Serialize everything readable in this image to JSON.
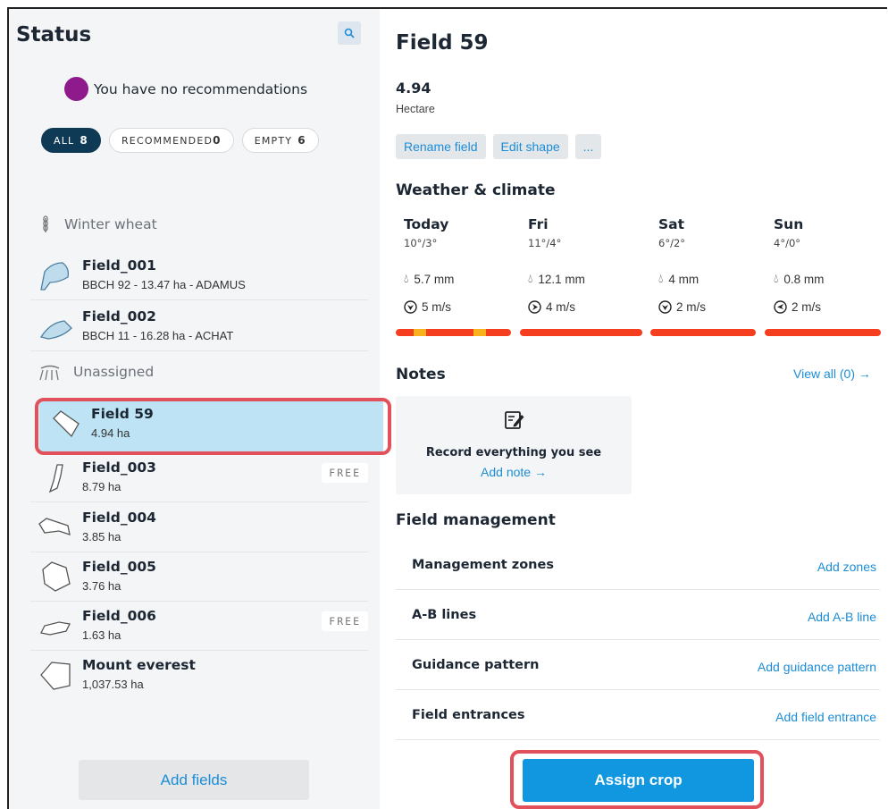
{
  "sidebar": {
    "title": "Status",
    "recommendation_text": "You have no recommendations",
    "filters": [
      {
        "label": "ALL",
        "count": "8"
      },
      {
        "label": "RECOMMENDED",
        "count": "0"
      },
      {
        "label": "EMPTY",
        "count": "6"
      }
    ],
    "groups": [
      {
        "label": "Winter wheat",
        "icon": "wheat-icon"
      },
      {
        "label": "Unassigned",
        "icon": "tractor-field-icon"
      }
    ],
    "fields": [
      {
        "name": "Field_001",
        "sub": "BBCH 92 - 13.47 ha - ADAMUS"
      },
      {
        "name": "Field_002",
        "sub": "BBCH 11 - 16.28 ha - ACHAT"
      },
      {
        "name": "Field 59",
        "sub": "4.94 ha"
      },
      {
        "name": "Field_003",
        "sub": "8.79 ha",
        "badge": "FREE"
      },
      {
        "name": "Field_004",
        "sub": "3.85 ha"
      },
      {
        "name": "Field_005",
        "sub": "3.76 ha"
      },
      {
        "name": "Field_006",
        "sub": "1.63 ha",
        "badge": "FREE"
      },
      {
        "name": "Mount everest",
        "sub": "1,037.53 ha"
      }
    ],
    "add_fields_label": "Add fields"
  },
  "detail": {
    "title": "Field 59",
    "area_value": "4.94",
    "area_unit": "Hectare",
    "actions": [
      "Rename field",
      "Edit shape",
      "..."
    ],
    "weather_title": "Weather & climate",
    "days": [
      {
        "name": "Today",
        "temps": "10°/3°",
        "rain": "5.7 mm",
        "wind": "5 m/s"
      },
      {
        "name": "Fri",
        "temps": "11°/4°",
        "rain": "12.1 mm",
        "wind": "4 m/s"
      },
      {
        "name": "Sat",
        "temps": "6°/2°",
        "rain": "4 mm",
        "wind": "2 m/s"
      },
      {
        "name": "Sun",
        "temps": "4°/0°",
        "rain": "0.8 mm",
        "wind": "2 m/s"
      }
    ],
    "notes_title": "Notes",
    "view_all": "View all (0) →",
    "note_prompt": "Record everything you see",
    "add_note": "Add note →",
    "mgmt_title": "Field management",
    "mgmt_rows": [
      {
        "label": "Management zones",
        "action": "Add zones"
      },
      {
        "label": "A-B lines",
        "action": "Add A-B line"
      },
      {
        "label": "Guidance pattern",
        "action": "Add guidance pattern"
      },
      {
        "label": "Field entrances",
        "action": "Add field entrance"
      }
    ],
    "assign_crop": "Assign crop"
  },
  "colors": {
    "accent": "#1197e0",
    "link": "#1c8dd6",
    "selected_row": "#bde3f4",
    "highlight_outline": "#e2515b",
    "spray_bad": "#f53d1f",
    "spray_ok": "#f7b21c",
    "recommendation_dot": "#8e1a8c"
  }
}
